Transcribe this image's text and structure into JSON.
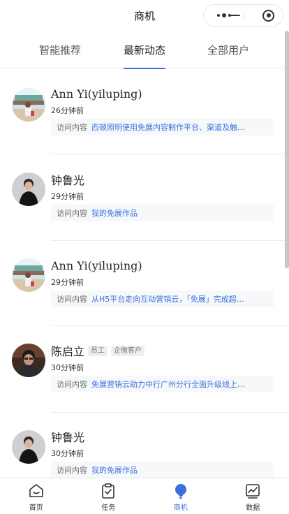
{
  "header": {
    "title": "商机"
  },
  "tabs": [
    {
      "label": "智能推荐"
    },
    {
      "label": "最新动态"
    },
    {
      "label": "全部用户"
    }
  ],
  "feed": {
    "visit_label": "访问内容",
    "items": [
      {
        "name": "Ann Yi(yiluping)",
        "time": "26分钟前",
        "content": "西顿照明使用免展内容制作平台、渠道及触…",
        "avatar": "photo-outdoor-person"
      },
      {
        "name": "钟鲁光",
        "time": "29分钟前",
        "content": "我的免展作品",
        "avatar": "photo-man-black-shirt"
      },
      {
        "name": "Ann Yi(yiluping)",
        "time": "29分钟前",
        "content": "从H5平台走向互动营销云，「免展」完成超…",
        "avatar": "photo-outdoor-person"
      },
      {
        "name": "陈启立",
        "tags": [
          "员工",
          "企微客户"
        ],
        "time": "30分钟前",
        "content": "免展营销云助力中行广州分行全面升级线上…",
        "avatar": "photo-man-glasses"
      },
      {
        "name": "钟鲁光",
        "time": "30分钟前",
        "content": "我的免展作品",
        "avatar": "photo-man-black-shirt"
      }
    ]
  },
  "bottom_nav": [
    {
      "label": "首页",
      "icon": "home-icon"
    },
    {
      "label": "任务",
      "icon": "task-clipboard-icon"
    },
    {
      "label": "商机",
      "icon": "lightbulb-icon"
    },
    {
      "label": "数据",
      "icon": "chart-icon"
    }
  ],
  "colors": {
    "accent": "#3a6fe0"
  }
}
